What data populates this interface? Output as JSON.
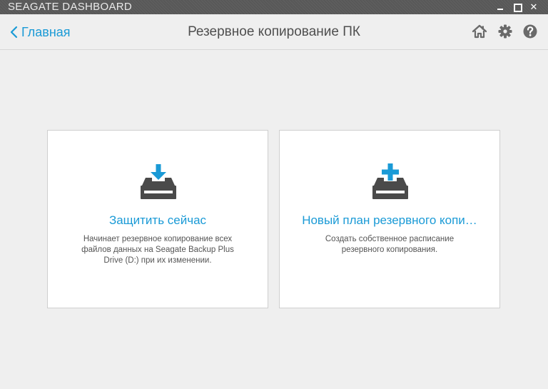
{
  "window": {
    "title": "SEAGATE DASHBOARD",
    "controls": {
      "minimize": "minimize",
      "maximize": "maximize",
      "close": "✕"
    }
  },
  "nav": {
    "back_label": "Главная",
    "page_title": "Резервное копирование ПК",
    "icons": [
      "home-icon",
      "gear-icon",
      "help-icon"
    ]
  },
  "cards": [
    {
      "title": "Защитить сейчас",
      "description": "Начинает резервное копирование всех файлов данных на Seagate Backup Plus Drive (D:) при их изменении.",
      "icon": "backup-download-icon"
    },
    {
      "title": "Новый план резервного копи…",
      "description": "Создать собственное расписание резервного копирования.",
      "icon": "add-plan-icon"
    }
  ],
  "colors": {
    "accent": "#1a9ad6",
    "titlebar": "#585858",
    "background": "#efefef",
    "icon_dark": "#4a4a4a"
  }
}
